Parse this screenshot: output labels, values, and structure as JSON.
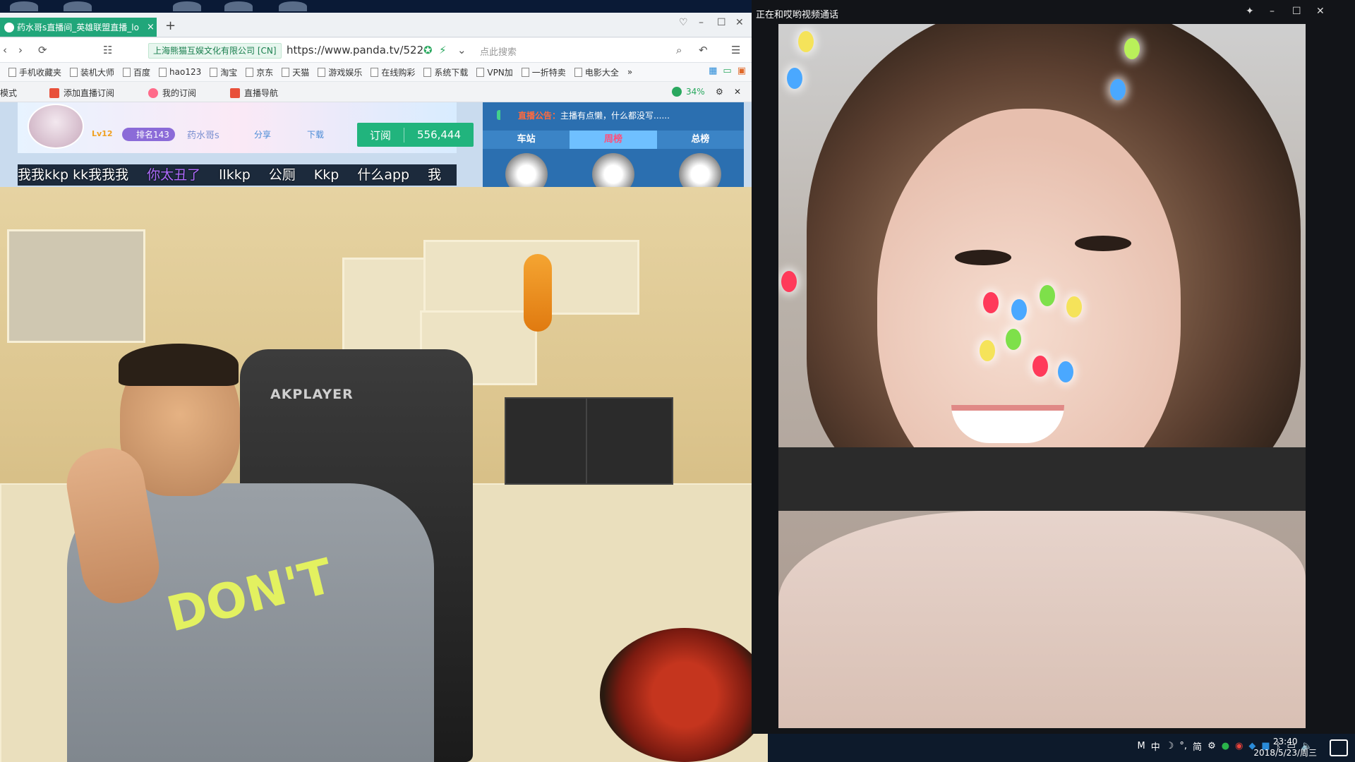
{
  "browser": {
    "tab_title": "药水哥s直播间_英雄联盟直播_lo",
    "tab_close": "×",
    "new_tab": "+",
    "ssl_label": "上海熊猫互娱文化有限公司 [CN]",
    "url": "https://www.panda.tv/522",
    "search_placeholder": "点此搜索",
    "bookmarks": [
      "手机收藏夹",
      "装机大师",
      "百度",
      "hao123",
      "淘宝",
      "京东",
      "天猫",
      "游戏娱乐",
      "在线购彩",
      "系统下载",
      "VPN加",
      "一折特卖",
      "电影大全",
      "»"
    ],
    "site_mode": "模式",
    "site_actions": [
      "添加直播订阅",
      "我的订阅",
      "直播导航"
    ],
    "battery": "34%"
  },
  "stream": {
    "level": "Lv12",
    "rank": "排名143",
    "streamer_name": "药水哥s",
    "share": "分享",
    "download": "下载",
    "subscribe_label": "订阅",
    "subscribe_count": "556,444",
    "danmu": [
      "我我kkp kk我我我",
      "你太丑了",
      "llkkp",
      "公厕",
      "Kkp",
      "什么app",
      "我"
    ],
    "notice_label": "直播公告：",
    "notice_text": "主播有点懒，什么都没写......",
    "rank_tabs": [
      "车站",
      "周榜",
      "总榜"
    ],
    "rank_active": 1
  },
  "camera": {
    "chair_brand": "AKPLAYER",
    "shirt_text": "DON'T"
  },
  "call_window": {
    "title": "正在和哎哟视频通话"
  },
  "taskbar": {
    "ime": [
      "M",
      "中",
      "☽",
      "°,",
      "简",
      "⚙"
    ],
    "time": "23:40",
    "date": "2018/5/23/周三"
  }
}
